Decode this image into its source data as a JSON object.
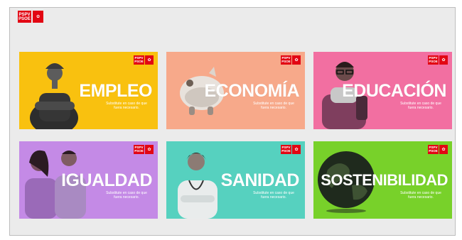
{
  "logo": {
    "text_line1": "PSPV",
    "text_line2": "PSOE",
    "rose": "✿"
  },
  "cards": [
    {
      "title": "EMPLEO",
      "subtitle_line1": "Substitute en caso de que",
      "subtitle_line2": "fuera necesario.",
      "bg": "#f9c10f",
      "figure": "worker-figure"
    },
    {
      "title": "ECONOMÍA",
      "subtitle_line1": "Substitute en caso de que",
      "subtitle_line2": "fuera necesario.",
      "bg": "#f7a98a",
      "figure": "piggy-bank-figure"
    },
    {
      "title": "EDUCACIÓN",
      "subtitle_line1": "Substitute en caso de que",
      "subtitle_line2": "fuera necesario.",
      "bg": "#f26fa1",
      "figure": "student-figure"
    },
    {
      "title": "IGUALDAD",
      "subtitle_line1": "Substitute en caso de que",
      "subtitle_line2": "fuera necesario.",
      "bg": "#c48ae6",
      "figure": "couple-figure"
    },
    {
      "title": "SANIDAD",
      "subtitle_line1": "Substitute en caso de que",
      "subtitle_line2": "fuera necesario.",
      "bg": "#56d1bf",
      "figure": "doctor-figure"
    },
    {
      "title": "SOSTENIBILIDAD",
      "subtitle_line1": "Substitute en caso de que",
      "subtitle_line2": "fuera necesario.",
      "bg": "#78d12a",
      "figure": "globe-figure"
    }
  ]
}
